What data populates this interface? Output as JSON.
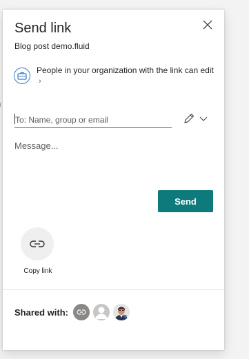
{
  "dialog": {
    "title": "Send link",
    "filename": "Blog post demo.fluid",
    "close_icon": "close-icon"
  },
  "permission": {
    "text": "People in your organization with the link can edit",
    "icon": "briefcase-icon",
    "chevron_icon": "chevron-right-icon",
    "chevron_glyph": "›"
  },
  "recipients": {
    "placeholder": "To: Name, group or email",
    "value": "",
    "edit_icon": "pencil-icon",
    "dropdown_icon": "chevron-down-icon"
  },
  "message": {
    "placeholder": "Message...",
    "value": ""
  },
  "send_button": {
    "label": "Send",
    "color": "#0f7a7c"
  },
  "copy_link": {
    "label": "Copy link",
    "icon": "link-icon"
  },
  "shared": {
    "label": "Shared with:",
    "avatars": [
      {
        "kind": "link-icon"
      },
      {
        "kind": "person-icon"
      },
      {
        "kind": "user-photo"
      }
    ]
  },
  "colors": {
    "accent": "#0f7a7c",
    "permission_icon": "#3a7ebd",
    "text": "#252423"
  }
}
